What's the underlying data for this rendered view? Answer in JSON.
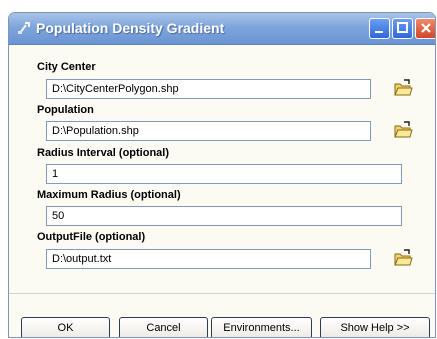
{
  "window": {
    "title": "Population Density Gradient"
  },
  "fields": [
    {
      "label": "City Center",
      "value": "D:\\CityCenterPolygon.shp",
      "browse": true
    },
    {
      "label": "Population",
      "value": "D:\\Population.shp",
      "browse": true
    },
    {
      "label": "Radius Interval (optional)",
      "value": "1",
      "browse": false
    },
    {
      "label": "Maximum Radius (optional)",
      "value": "50",
      "browse": false
    },
    {
      "label": "OutputFile (optional)",
      "value": "D:\\output.txt",
      "browse": true
    }
  ],
  "buttons": {
    "ok": "OK",
    "cancel": "Cancel",
    "environments": "Environments...",
    "show_help": "Show Help >>"
  },
  "icons": {
    "title": "tool-icon",
    "browse": "open-folder-icon"
  }
}
